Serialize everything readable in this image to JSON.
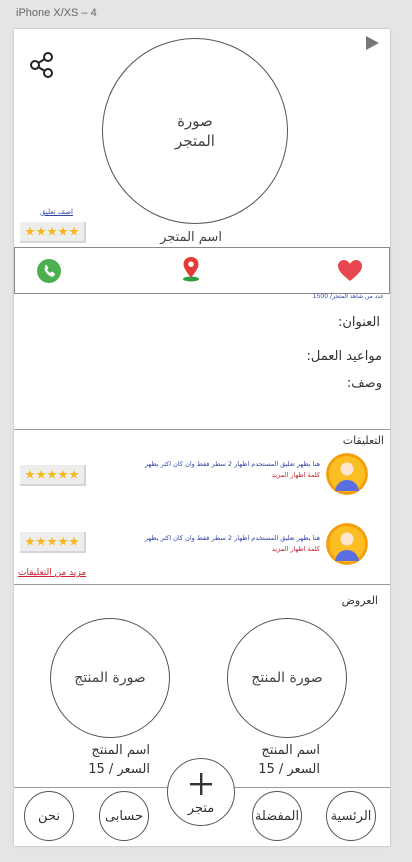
{
  "frame": {
    "label": "iPhone X/XS – 4"
  },
  "header": {
    "store_photo_line1": "صورة",
    "store_photo_line2": "المتجر",
    "store_name": "اسم المتجر",
    "add_review_link": "اضف تعليق",
    "rating_stars": 5
  },
  "actions": {
    "views_text": "عدد من شاهد المتجر/ 1500"
  },
  "info": {
    "address_label": "العنوان:",
    "hours_label": "مواعيد العمل:",
    "description_label": "وصف:"
  },
  "comments": {
    "title": "التعليقات",
    "items": [
      {
        "line1": "هنا يظهر تعليق المستخدم اظهار 2 سطر فقط  وان كان اكثر يظهر",
        "line2": "كلمة اظهار المزيد",
        "stars": 5
      },
      {
        "line1": "هنا يظهر تعليق المستخدم اظهار 2 سطر فقط  وان كان اكثر يظهر",
        "line2": "كلمة اظهار المزيد",
        "stars": 5
      }
    ],
    "more_link": "مزيد من التعليقات"
  },
  "offers": {
    "title": "العروض",
    "products": [
      {
        "photo": "صورة المنتج",
        "name": "اسم المنتج",
        "price": "السعر / 15"
      },
      {
        "photo": "صورة المنتج",
        "name": "اسم المنتج",
        "price": "السعر / 15"
      }
    ]
  },
  "tabbar": {
    "home": "الرئسية",
    "favorites": "المفضلة",
    "store": "متجر",
    "account": "حسابى",
    "about": "نحن"
  },
  "colors": {
    "phone": "#4caf50",
    "heart": "#e8464e",
    "pin": "#e53935",
    "star": "#f6b81e",
    "link": "#3344aa",
    "accent_red": "#cc2233"
  }
}
